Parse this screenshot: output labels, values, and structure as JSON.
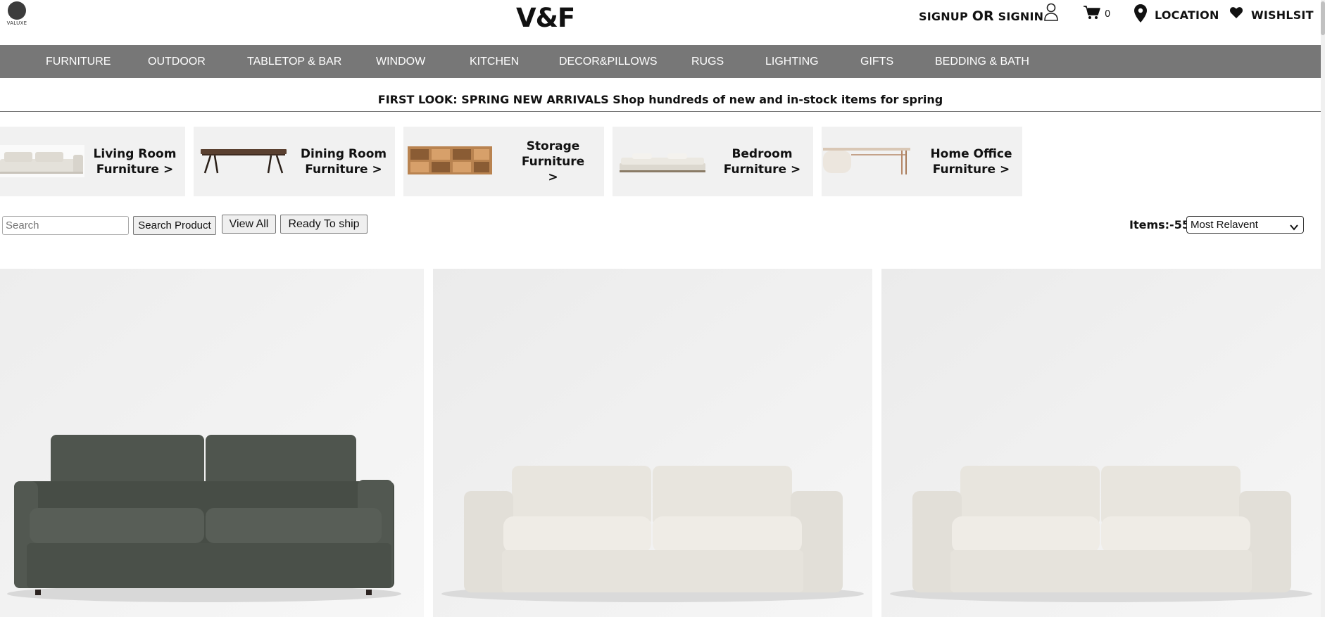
{
  "header": {
    "logo_text": "VALUXE",
    "brand": "V&F",
    "signup": "SIGNUP",
    "or": "OR",
    "signin": "SIGNIN",
    "cart_count": "0",
    "location": "LOCATION",
    "wishlist": "WISHLSIT"
  },
  "nav": {
    "items": [
      "FURNITURE",
      "OUTDOOR",
      "TABLETOP & BAR",
      "WINDOW",
      "KITCHEN",
      "DECOR&PILLOWS",
      "RUGS",
      "LIGHTING",
      "GIFTS",
      "BEDDING & BATH"
    ]
  },
  "banner": {
    "text": "FIRST LOOK: SPRING NEW ARRIVALS Shop hundreds of new and in-stock items for spring"
  },
  "categories": [
    {
      "line1": "Living Room",
      "line2": "Furniture >"
    },
    {
      "line1": "Dining Room",
      "line2": "Furniture >"
    },
    {
      "line1": "Storage Furniture",
      "line2": ">"
    },
    {
      "line1": "Bedroom",
      "line2": "Furniture >"
    },
    {
      "line1": "Home Office",
      "line2": "Furniture >"
    }
  ],
  "filters": {
    "search_placeholder": "Search",
    "search_button": "Search Product",
    "view_all": "View All",
    "ready_to_ship": "Ready To ship",
    "items_count": "Items:-55",
    "sort_selected": "Most Relavent"
  },
  "colors": {
    "nav_bg": "#777777",
    "category_bg": "#f1f1f1",
    "sofa_dark": "#4a5048",
    "sofa_light": "#e6e3dc"
  },
  "products": [
    {
      "image": "charcoal-sofa"
    },
    {
      "image": "ivory-sofa"
    },
    {
      "image": "ivory-sofa"
    }
  ]
}
